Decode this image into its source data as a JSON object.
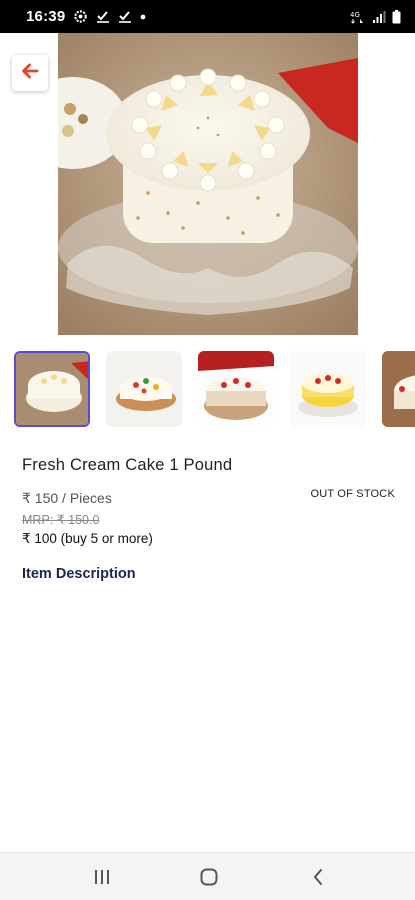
{
  "status_bar": {
    "time": "16:39",
    "left_icons": [
      "settings-gear-icon",
      "task-check-icon",
      "task-check-icon",
      "dot-icon"
    ],
    "right_icons": [
      "network-4g-icon",
      "signal-icon",
      "battery-icon"
    ]
  },
  "product": {
    "title": "Fresh Cream Cake 1 Pound",
    "price": "₹ 150 / Pieces",
    "stock_status": "OUT OF STOCK",
    "mrp": "MRP: ₹ 150.0",
    "bulk_price": "₹ 100 (buy 5 or more)",
    "description_heading": "Item Description"
  },
  "gallery": {
    "selected_index": 0,
    "thumbnails": [
      "butterscotch-cake",
      "fruit-cream-cake",
      "cherry-cream-cake",
      "pineapple-cake",
      "butterscotch-cake-2"
    ]
  },
  "colors": {
    "accent": "#5b4ad6",
    "back_arrow": "#e8412c",
    "heading": "#1d2550"
  },
  "nav_bar": {
    "icons": [
      "recent-apps-icon",
      "home-icon",
      "back-nav-icon"
    ]
  }
}
